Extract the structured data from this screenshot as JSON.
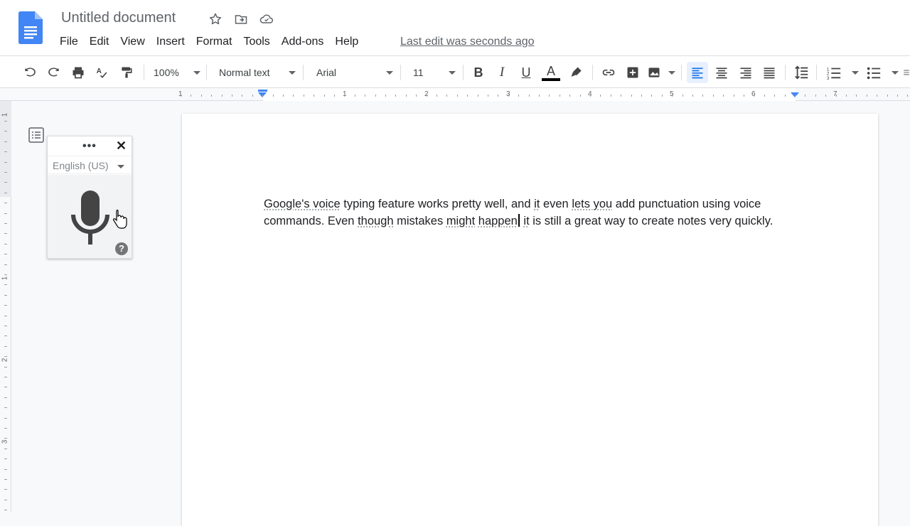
{
  "header": {
    "title": "Untitled document",
    "menu": [
      "File",
      "Edit",
      "View",
      "Insert",
      "Format",
      "Tools",
      "Add-ons",
      "Help"
    ],
    "last_edit": "Last edit was seconds ago"
  },
  "toolbar": {
    "zoom": "100%",
    "style": "Normal text",
    "font": "Arial",
    "font_size": "11",
    "text_color": "#000000",
    "accent": "#1a73e8"
  },
  "ruler": {
    "labels": [
      "1",
      "1",
      "2",
      "3",
      "4",
      "5",
      "6",
      "7"
    ],
    "vertical_labels": [
      "1",
      "1",
      "2",
      "3"
    ]
  },
  "voice_typing": {
    "menu_dots": "•••",
    "close": "✕",
    "language": "English (US)",
    "help": "?"
  },
  "document": {
    "seg1_sq": "Google's voice",
    "seg2": " typing feature works pretty well, and ",
    "seg3_sq": "it",
    "seg4": " even ",
    "seg5_sq": "lets you",
    "seg6": " add punctuation using voice commands. Even ",
    "seg7_sq": "though",
    "seg8": " mistakes ",
    "seg9_sq": "might",
    "seg10": " ",
    "seg11_sq": "happen",
    "seg12": " ",
    "seg13_sq": "it",
    "seg14": " is still a great way to create notes very quickly."
  }
}
